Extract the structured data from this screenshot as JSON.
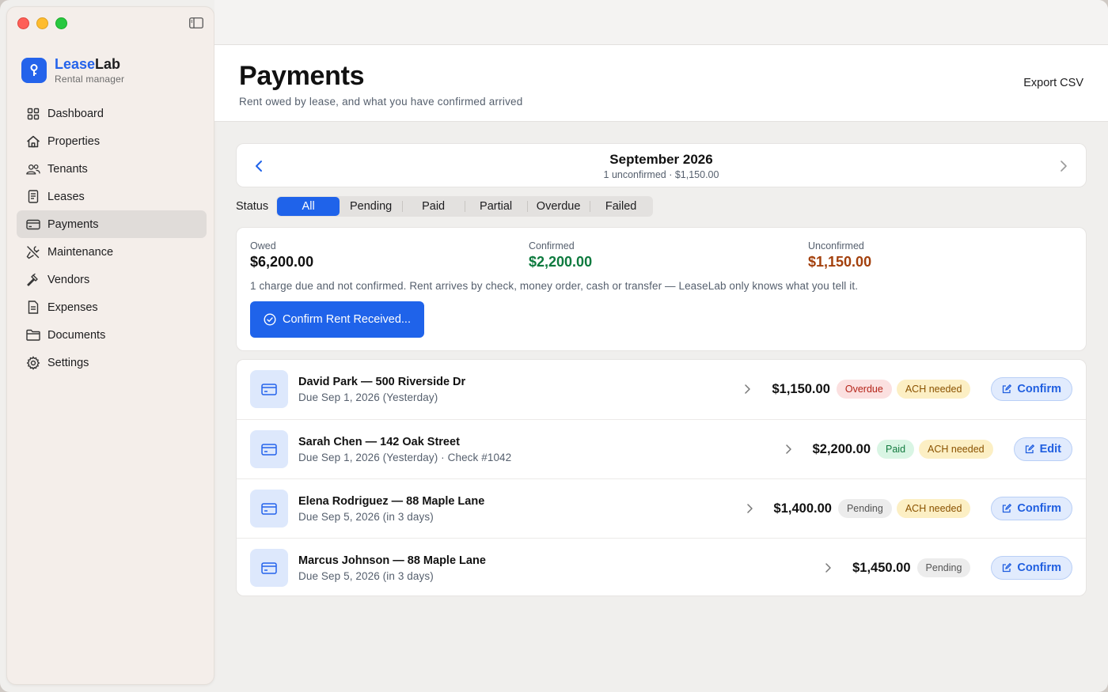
{
  "app": {
    "name_accent": "Lease",
    "name_rest": "Lab",
    "subtitle": "Rental manager"
  },
  "sidebar": {
    "items": [
      {
        "label": "Dashboard",
        "icon": "grid-icon"
      },
      {
        "label": "Properties",
        "icon": "house-icon"
      },
      {
        "label": "Tenants",
        "icon": "people-icon"
      },
      {
        "label": "Leases",
        "icon": "document-icon"
      },
      {
        "label": "Payments",
        "icon": "credit-card-icon",
        "active": true
      },
      {
        "label": "Maintenance",
        "icon": "tools-icon"
      },
      {
        "label": "Vendors",
        "icon": "hammer-icon"
      },
      {
        "label": "Expenses",
        "icon": "receipt-icon"
      },
      {
        "label": "Documents",
        "icon": "folder-icon"
      },
      {
        "label": "Settings",
        "icon": "gear-icon"
      }
    ]
  },
  "header": {
    "title": "Payments",
    "subtitle": "Rent owed by lease, and what you have confirmed arrived",
    "export_label": "Export CSV"
  },
  "month": {
    "title": "September 2026",
    "subtitle": "1 unconfirmed · $1,150.00"
  },
  "status_filter": {
    "label": "Status",
    "options": [
      "All",
      "Pending",
      "Paid",
      "Partial",
      "Overdue",
      "Failed"
    ],
    "selected": "All"
  },
  "summary": {
    "owed_label": "Owed",
    "owed_value": "$6,200.00",
    "confirmed_label": "Confirmed",
    "confirmed_value": "$2,200.00",
    "unconfirmed_label": "Unconfirmed",
    "unconfirmed_value": "$1,150.00",
    "note": "1 charge due and not confirmed. Rent arrives by check, money order, cash or transfer — LeaseLab only knows what you tell it.",
    "confirm_button": "Confirm Rent Received..."
  },
  "payments": [
    {
      "title": "David Park — 500 Riverside Dr",
      "sub": "Due Sep 1, 2026 (Yesterday)",
      "amount": "$1,150.00",
      "status": "Overdue",
      "status_kind": "overdue",
      "ach": "ACH needed",
      "action": "Confirm"
    },
    {
      "title": "Sarah Chen — 142 Oak Street",
      "sub": "Due Sep 1, 2026 (Yesterday) · Check #1042",
      "amount": "$2,200.00",
      "status": "Paid",
      "status_kind": "paid",
      "ach": "ACH needed",
      "action": "Edit"
    },
    {
      "title": "Elena Rodriguez — 88 Maple Lane",
      "sub": "Due Sep 5, 2026 (in 3 days)",
      "amount": "$1,400.00",
      "status": "Pending",
      "status_kind": "pending",
      "ach": "ACH needed",
      "action": "Confirm"
    },
    {
      "title": "Marcus Johnson — 88 Maple Lane",
      "sub": "Due Sep 5, 2026 (in 3 days)",
      "amount": "$1,450.00",
      "status": "Pending",
      "status_kind": "pending",
      "ach": "",
      "action": "Confirm"
    }
  ],
  "colors": {
    "accent": "#1f63ea",
    "confirmed": "#0d7a3e",
    "unconfirmed": "#a3400c"
  }
}
